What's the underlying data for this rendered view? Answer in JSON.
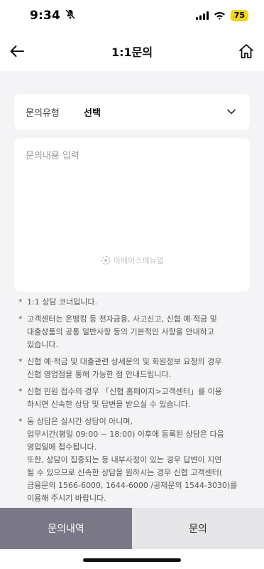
{
  "status_bar": {
    "time": "9:34",
    "battery": "75",
    "icons": [
      "bell-slash-icon",
      "signal-icon",
      "wifi-icon",
      "battery-icon"
    ]
  },
  "header": {
    "title": "1:1문의",
    "back_icon": "arrow-left-icon",
    "home_icon": "home-icon"
  },
  "form": {
    "type_label": "문의유형",
    "type_value": "선택",
    "content_placeholder": "문의내용 입력",
    "watermark": "아베이스페뉴얼"
  },
  "notices": [
    {
      "mark": "*",
      "text": "1:1 상담 코너입니다."
    },
    {
      "mark": "*",
      "text": "고객센터는 온뱅킹 등 전자금융, 사고신고, 신협 예·적금 및\n대출상품의 공통 일반사항 등의 기본적인 사항을 안내하고\n있습니다."
    },
    {
      "mark": "*",
      "text": "신협 예·적금 및 대출관련 상세문의 및 회원정보 요청의 경우\n신협 영업점을 통해 가능한 점 안내드립니다."
    },
    {
      "mark": "*",
      "text": "신협 민원 접수의 경우 「신협 홈페이지>고객센터」를 이용\n하시면 신속한 상담 및 답변을 받으실 수 있습니다."
    },
    {
      "mark": "*",
      "text": "동 상담은 실시간 상담이 아니며,\n업무시간(평일 09:00 ~ 18:00) 이후에 등록된 상담은 다음\n영업일에 접수됩니다.\n또한, 상담이 집중되는 등 내부사정이 있는 경우 답변이 지연\n될 수 있으므로 신속한 상담을 원하시는 경우 신협 고객센터(\n금융문의 1566-6000, 1644-6000 /공제문의 1544-3030)를\n이용해 주시기 바랍니다."
    }
  ],
  "bottom": {
    "history_label": "문의내역",
    "inquiry_label": "문의"
  },
  "colors": {
    "history_bg": "#7a7886",
    "inquiry_bg": "#e6e6e8",
    "battery": "#f2d31b"
  }
}
